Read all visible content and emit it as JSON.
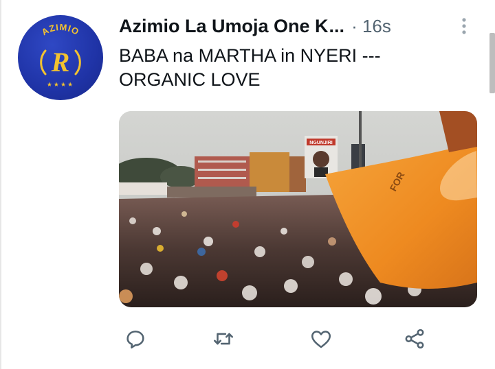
{
  "account": {
    "display_name": "Azimio La Umoja One K",
    "truncation": "...",
    "meta": "· 16s",
    "avatar": {
      "logo_text": "AZIMIO",
      "monogram": "R",
      "stars": "★★★★"
    }
  },
  "tweet": {
    "text_line1": "BABA na MARTHA in NYERI ---",
    "text_line2": "ORGANIC LOVE"
  },
  "media": {
    "billboard_text": "NGUNJIRI",
    "flag_text": "FOR"
  },
  "actions": [
    {
      "icon": "reply-icon"
    },
    {
      "icon": "retweet-icon"
    },
    {
      "icon": "like-icon"
    },
    {
      "icon": "share-icon"
    }
  ],
  "colors": {
    "avatar_blue": "#1f33a6",
    "avatar_gold": "#f2c230",
    "meta_gray": "#536471",
    "flag_orange": "#f7941d"
  }
}
